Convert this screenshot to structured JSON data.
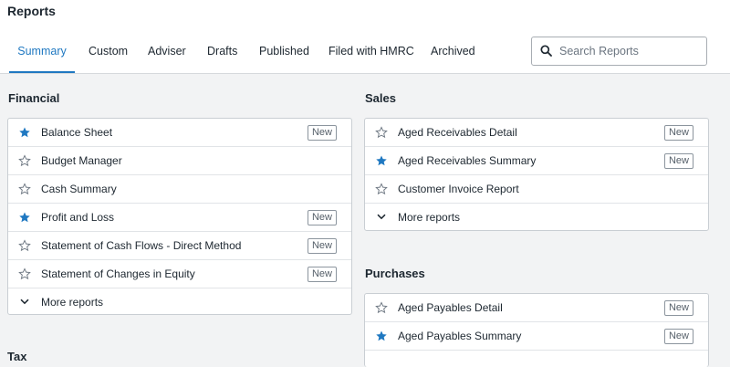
{
  "header": {
    "title": "Reports"
  },
  "tabs": [
    {
      "label": "Summary",
      "active": true
    },
    {
      "label": "Custom",
      "active": false
    },
    {
      "label": "Adviser",
      "active": false
    },
    {
      "label": "Drafts",
      "active": false
    },
    {
      "label": "Published",
      "active": false
    },
    {
      "label": "Filed with HMRC",
      "active": false
    },
    {
      "label": "Archived",
      "active": false
    }
  ],
  "search": {
    "placeholder": "Search Reports",
    "value": "",
    "icon": "search-icon"
  },
  "colors": {
    "accent": "#1f78c1",
    "star_filled": "#1f78c1",
    "star_empty": "#6b7580"
  },
  "sections": {
    "financial": {
      "title": "Financial",
      "items": [
        {
          "label": "Balance Sheet",
          "starred": true,
          "badge": "New"
        },
        {
          "label": "Budget Manager",
          "starred": false,
          "badge": ""
        },
        {
          "label": "Cash Summary",
          "starred": false,
          "badge": ""
        },
        {
          "label": "Profit and Loss",
          "starred": true,
          "badge": "New"
        },
        {
          "label": "Statement of Cash Flows - Direct Method",
          "starred": false,
          "badge": "New"
        },
        {
          "label": "Statement of Changes in Equity",
          "starred": false,
          "badge": "New"
        }
      ],
      "more_label": "More reports"
    },
    "sales": {
      "title": "Sales",
      "items": [
        {
          "label": "Aged Receivables Detail",
          "starred": false,
          "badge": "New"
        },
        {
          "label": "Aged Receivables Summary",
          "starred": true,
          "badge": "New"
        },
        {
          "label": "Customer Invoice Report",
          "starred": false,
          "badge": ""
        }
      ],
      "more_label": "More reports"
    },
    "purchases": {
      "title": "Purchases",
      "items": [
        {
          "label": "Aged Payables Detail",
          "starred": false,
          "badge": "New"
        },
        {
          "label": "Aged Payables Summary",
          "starred": true,
          "badge": "New"
        }
      ]
    },
    "tax": {
      "title": "Tax"
    }
  }
}
